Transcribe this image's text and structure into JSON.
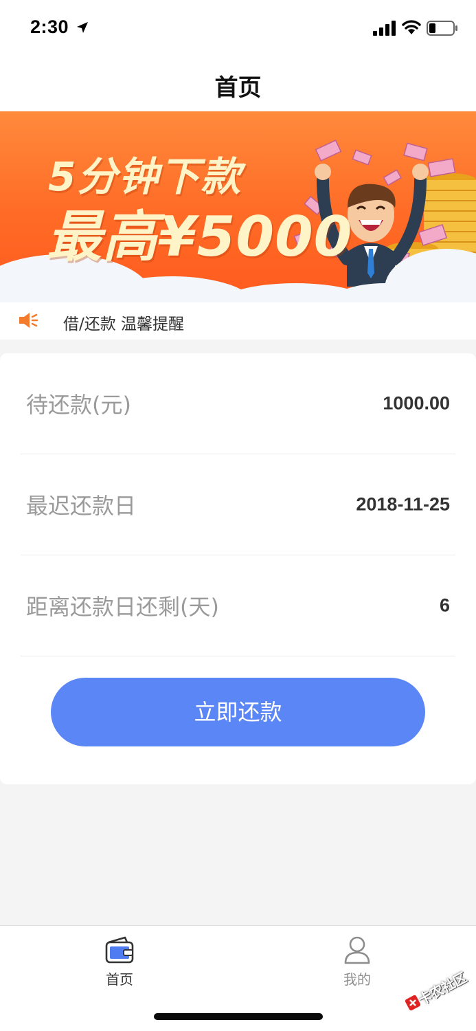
{
  "status_bar": {
    "time": "2:30"
  },
  "nav": {
    "title": "首页"
  },
  "banner": {
    "line1": "5分钟下款",
    "line2": "最高¥5000"
  },
  "notice": {
    "text": "借/还款 温馨提醒"
  },
  "summary": {
    "rows": [
      {
        "label": "待还款(元)",
        "value": "1000.00"
      },
      {
        "label": "最迟还款日",
        "value": "2018-11-25"
      },
      {
        "label": "距离还款日还剩(天)",
        "value": "6"
      }
    ],
    "repay_button": "立即还款"
  },
  "tab_bar": {
    "active": "home",
    "home_label": "首页",
    "mine_label": "我的"
  },
  "watermark": {
    "text": "卡农社区"
  },
  "colors": {
    "primary": "#5b86f5",
    "banner_orange": "#ff6a26",
    "notice_icon": "#f47a2c"
  }
}
